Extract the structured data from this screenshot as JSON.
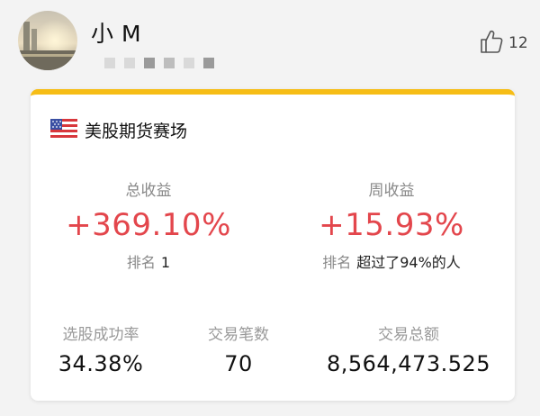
{
  "profile": {
    "username": "小 M",
    "avatar_icon": "avatar-sunset-photo"
  },
  "like": {
    "icon": "thumbs-up-icon",
    "count": "12"
  },
  "card": {
    "accent_color": "#f6bd16",
    "flag_icon": "us-flag-icon",
    "title": "美股期货赛场",
    "total_return": {
      "label": "总收益",
      "value": "+369.10%",
      "rank_label": "排名",
      "rank_value": "1"
    },
    "weekly_return": {
      "label": "周收益",
      "value": "+15.93%",
      "rank_label": "排名",
      "rank_value": "超过了94%的人"
    },
    "value_color": "#e3464c",
    "stats": [
      {
        "label": "选股成功率",
        "value": "34.38%"
      },
      {
        "label": "交易笔数",
        "value": "70"
      },
      {
        "label": "交易总额",
        "value": "8,564,473.525"
      }
    ]
  }
}
